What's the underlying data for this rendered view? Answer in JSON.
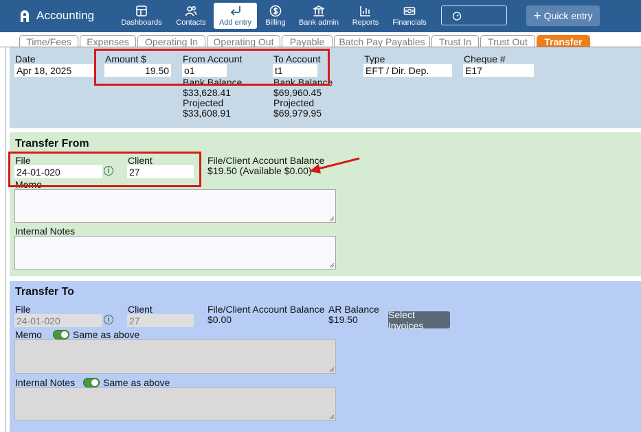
{
  "app": {
    "title": "Accounting"
  },
  "nav": {
    "dashboards": "Dashboards",
    "contacts": "Contacts",
    "add_entry": "Add entry",
    "billing": "Billing",
    "bank_admin": "Bank admin",
    "reports": "Reports",
    "financials": "Financials",
    "quick_entry": "Quick entry"
  },
  "tabs": [
    "Time/Fees",
    "Expenses",
    "Operating In",
    "Operating Out",
    "Payable",
    "Batch Pay Payables",
    "Trust In",
    "Trust Out",
    "Transfer"
  ],
  "active_tab": "Transfer",
  "header": {
    "date_label": "Date",
    "date_value": "Apr 18, 2025",
    "amount_label": "Amount $",
    "amount_value": "19.50",
    "from_label": "From Account",
    "from_value": "o1",
    "to_label": "To Account",
    "to_value": "t1",
    "type_label": "Type",
    "type_value": "EFT / Dir. Dep.",
    "cheque_label": "Cheque #",
    "cheque_value": "E17",
    "from_bank_label": "Bank Balance",
    "from_bank_value": "$33,628.41",
    "from_proj_label": "Projected",
    "from_proj_value": "$33,608.91",
    "to_bank_label": "Bank Balance",
    "to_bank_value": "$69,960.45",
    "to_proj_label": "Projected",
    "to_proj_value": "$69,979.95"
  },
  "transfer_from": {
    "title": "Transfer From",
    "file_label": "File",
    "file_value": "24-01-020",
    "client_label": "Client",
    "client_value": "27",
    "balance_label": "File/Client Account Balance",
    "balance_value": "$19.50 (Available $0.00)",
    "memo_label": "Memo",
    "notes_label": "Internal Notes"
  },
  "transfer_to": {
    "title": "Transfer To",
    "file_label": "File",
    "file_value": "24-01-020",
    "client_label": "Client",
    "client_value": "27",
    "balance_label": "File/Client Account Balance",
    "balance_value": "$0.00",
    "ar_label": "AR Balance",
    "ar_value": "$19.50",
    "select_invoices": "Select Invoices",
    "memo_label": "Memo",
    "memo_same": "Same as above",
    "notes_label": "Internal Notes",
    "notes_same": "Same as above"
  },
  "colors": {
    "topbar": "#2d5e93",
    "active_tab": "#ee7d1a",
    "header_bg": "#c7d9e6",
    "from_bg": "#d5ecd2",
    "to_bg": "#b7cdf6",
    "highlight": "#d51a1a"
  }
}
